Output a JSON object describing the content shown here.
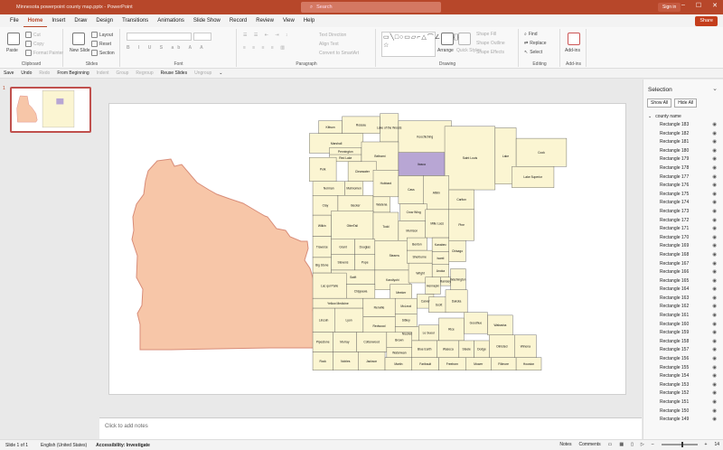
{
  "titlebar": {
    "app_title": "Minnesota powerpoint county map.pptx - PowerPoint",
    "search_placeholder": "Search",
    "signin": "Sign in"
  },
  "tabs": [
    "File",
    "Home",
    "Insert",
    "Draw",
    "Design",
    "Transitions",
    "Animations",
    "Slide Show",
    "Record",
    "Review",
    "View",
    "Help"
  ],
  "share_label": "Share",
  "ribbon": {
    "clipboard": {
      "label": "Clipboard",
      "paste": "Paste",
      "cut": "Cut",
      "copy": "Copy",
      "format_painter": "Format Painter"
    },
    "slides": {
      "label": "Slides",
      "new_slide": "New Slide",
      "layout": "Layout",
      "reset": "Reset",
      "section": "Section"
    },
    "font": {
      "label": "Font"
    },
    "paragraph": {
      "label": "Paragraph",
      "text_direction": "Text Direction",
      "align_text": "Align Text",
      "smartart": "Convert to SmartArt"
    },
    "drawing": {
      "label": "Drawing",
      "arrange": "Arrange",
      "quick_styles": "Quick Styles",
      "shape_fill": "Shape Fill",
      "shape_outline": "Shape Outline",
      "shape_effects": "Shape Effects"
    },
    "editing": {
      "label": "Editing",
      "find": "Find",
      "replace": "Replace",
      "select": "Select"
    },
    "addins": {
      "label": "Add-ins",
      "addins": "Add-ins"
    }
  },
  "qat": {
    "save": "Save",
    "undo": "Undo",
    "redo": "Redo",
    "from_beginning": "From Beginning",
    "indent": "Indent",
    "group": "Group",
    "regroup": "Regroup",
    "reuse_slides": "Reuse Slides",
    "ungroup": "Ungroup"
  },
  "thumb": {
    "number": "1"
  },
  "notes_placeholder": "Click to add notes",
  "selection": {
    "title": "Selection",
    "show_all": "Show All",
    "hide_all": "Hide All",
    "group_name": "county name",
    "items": [
      "Rectangle 183",
      "Rectangle 182",
      "Rectangle 181",
      "Rectangle 180",
      "Rectangle 179",
      "Rectangle 178",
      "Rectangle 177",
      "Rectangle 176",
      "Rectangle 175",
      "Rectangle 174",
      "Rectangle 173",
      "Rectangle 172",
      "Rectangle 171",
      "Rectangle 170",
      "Rectangle 169",
      "Rectangle 168",
      "Rectangle 167",
      "Rectangle 166",
      "Rectangle 165",
      "Rectangle 164",
      "Rectangle 163",
      "Rectangle 162",
      "Rectangle 161",
      "Rectangle 160",
      "Rectangle 159",
      "Rectangle 158",
      "Rectangle 157",
      "Rectangle 156",
      "Rectangle 155",
      "Rectangle 154",
      "Rectangle 153",
      "Rectangle 152",
      "Rectangle 151",
      "Rectangle 150",
      "Rectangle 149"
    ]
  },
  "status": {
    "slide": "Slide 1 of 1",
    "language": "English (United States)",
    "accessibility": "Accessibility: Investigate",
    "notes": "Notes",
    "comments": "Comments",
    "zoom": "14"
  },
  "map": {
    "fill_color": "#fbf5d2",
    "highlight_color": "#b8a6d4",
    "outline_fill": "#f7c6a8",
    "counties": [
      "Kittson",
      "Roseau",
      "Lake of the Woods",
      "Marshall",
      "Pennington",
      "Red Lake",
      "Polk",
      "Koochiching",
      "Beltrami",
      "Clearwater",
      "Norman",
      "Mahnomen",
      "Itasca",
      "Saint Louis",
      "Lake",
      "Cook",
      "Lake Superior",
      "Clay",
      "Becker",
      "Hubbard",
      "Cass",
      "Aitkin",
      "Carlton",
      "Wadena",
      "Crow Wing",
      "Wilkin",
      "OtterTail",
      "Todd",
      "Pine",
      "Morrison",
      "Mille Lacs",
      "Kanabec",
      "Grant",
      "Douglas",
      "Traverse",
      "Stevens",
      "Pope",
      "Stearns",
      "Benton",
      "Isanti",
      "Chisago",
      "Big Stone",
      "Sherburne",
      "Anoka",
      "Swift",
      "Kandiyohi",
      "Wright",
      "Ramsey",
      "Washington",
      "Chippewa",
      "Hennepin",
      "Lac qui Parle",
      "Meeker",
      "Yellow Medicine",
      "Renville",
      "McLeod",
      "Carver",
      "Scott",
      "Dakota",
      "Sibley",
      "Redwood",
      "Lincoln",
      "Lyon",
      "Nicollet",
      "Le Sueur",
      "Rice",
      "Goodhue",
      "Wabasha",
      "Pipestone",
      "Murray",
      "Cottonwood",
      "Brown",
      "Watonwan",
      "Blue Earth",
      "Waseca",
      "Steele",
      "Dodge",
      "Olmsted",
      "Winona",
      "Rock",
      "Nobles",
      "Jackson",
      "Martin",
      "Faribault",
      "Freeborn",
      "Mower",
      "Fillmore",
      "Houston"
    ]
  }
}
